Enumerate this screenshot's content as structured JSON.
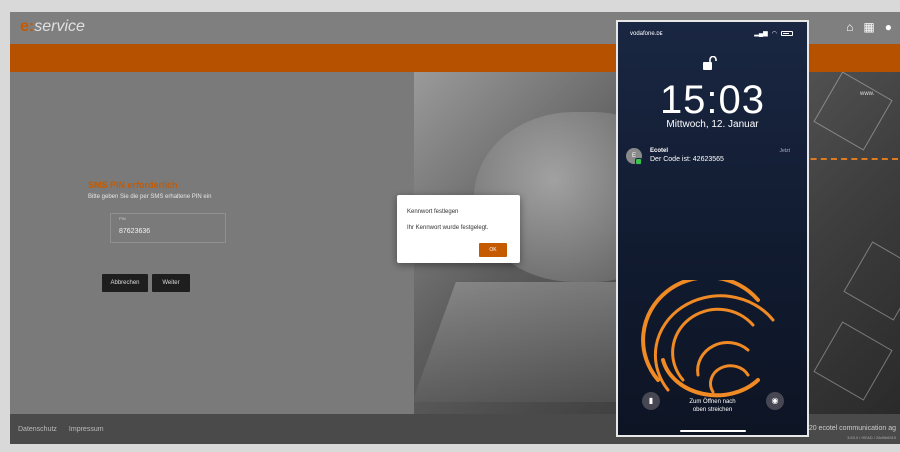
{
  "app": {
    "logo_prefix": "e:",
    "logo_suffix": "service"
  },
  "form": {
    "heading": "SMS PIN erforderlich",
    "subtitle": "Bitte geben Sie die per SMS erhaltene PIN ein",
    "pin_label": "PIN",
    "pin_value": "87623636",
    "cancel_label": "Abbrechen",
    "next_label": "Weiter"
  },
  "dialog": {
    "title": "Kennwort festlegen",
    "message": "Ihr Kennwort wurde festgelegt.",
    "ok_label": "OK"
  },
  "footer": {
    "link_privacy": "Datenschutz",
    "link_imprint": "Impressum",
    "copyright": "20 ecotel communication ag",
    "version": "3.63.0 / HEAD / 26d5b6919"
  },
  "background": {
    "www_label": "www."
  },
  "phone": {
    "carrier": "vodafone.ᴅᴇ",
    "time": "15:03",
    "date": "Mittwoch, 12. Januar",
    "notification": {
      "avatar_letter": "E",
      "app": "Ecotel",
      "text": "Der Code ist: 42623565",
      "time": "Jetzt"
    },
    "unlock_hint_line1": "Zum Öffnen nach",
    "unlock_hint_line2": "oben streichen"
  },
  "colors": {
    "accent": "#c55a00",
    "header_bar": "#b65100",
    "dialog_button": "#c55a00",
    "dashed_line": "#e07a1f"
  },
  "icons": [
    "home-icon",
    "apps-grid-icon",
    "user-account-icon",
    "unlocked-padlock-icon",
    "flashlight-icon",
    "camera-icon",
    "signal-icon",
    "wifi-icon",
    "battery-icon"
  ]
}
